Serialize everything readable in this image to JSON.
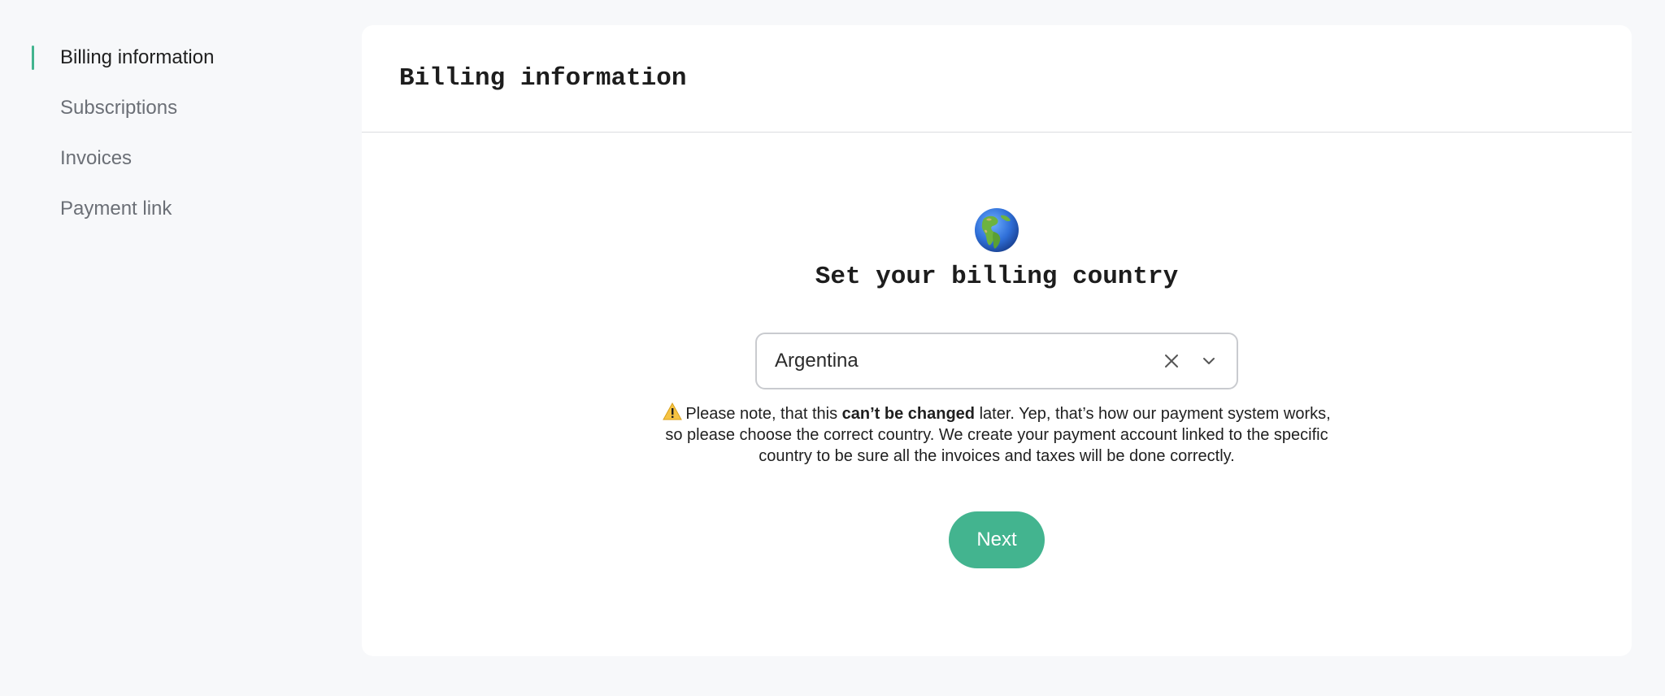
{
  "sidebar": {
    "items": [
      {
        "label": "Billing information",
        "active": true
      },
      {
        "label": "Subscriptions",
        "active": false
      },
      {
        "label": "Invoices",
        "active": false
      },
      {
        "label": "Payment link",
        "active": false
      }
    ]
  },
  "card": {
    "title": "Billing information",
    "heading": "Set your billing country",
    "globe_icon": "globe-americas-icon",
    "country_select": {
      "value": "Argentina",
      "clear_icon": "close-icon",
      "dropdown_icon": "chevron-down-icon"
    },
    "note": {
      "warning_icon": "warning-icon",
      "before": "Please note, that this ",
      "emphasis": "can’t be changed",
      "after": " later. Yep, that’s how our payment system works, so please choose the correct country. We create your payment account linked to the specific country to be sure all the invoices and taxes will be done correctly."
    },
    "next_label": "Next"
  },
  "colors": {
    "accent": "#43b48f",
    "background": "#f7f8fa",
    "card": "#ffffff",
    "muted_text": "#6b6f76"
  }
}
